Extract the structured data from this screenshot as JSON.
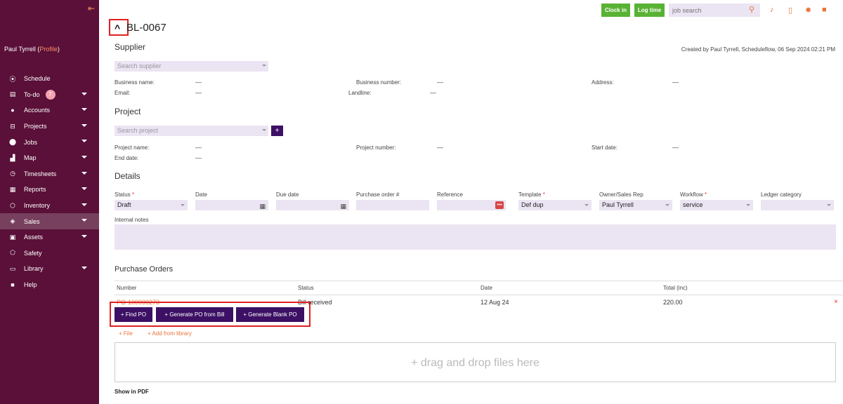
{
  "sidebar": {
    "collapse_icon": "collapse-left-icon",
    "user_name": "Paul Tyrrell",
    "profile_link": "Profile",
    "items": [
      {
        "label": "Schedule",
        "icon": "schedule-icon",
        "glyph": "⦿",
        "has_caret": false,
        "badge": ""
      },
      {
        "label": "To-do",
        "icon": "todo-icon",
        "glyph": "▤",
        "has_caret": true,
        "badge": "7"
      },
      {
        "label": "Accounts",
        "icon": "accounts-icon",
        "glyph": "●",
        "has_caret": true,
        "badge": ""
      },
      {
        "label": "Projects",
        "icon": "projects-icon",
        "glyph": "⊟",
        "has_caret": true,
        "badge": ""
      },
      {
        "label": "Jobs",
        "icon": "jobs-icon",
        "glyph": "⬤",
        "has_caret": true,
        "badge": ""
      },
      {
        "label": "Map",
        "icon": "map-icon",
        "glyph": "▟",
        "has_caret": true,
        "badge": ""
      },
      {
        "label": "Timesheets",
        "icon": "timesheets-icon",
        "glyph": "◷",
        "has_caret": true,
        "badge": ""
      },
      {
        "label": "Reports",
        "icon": "reports-icon",
        "glyph": "▦",
        "has_caret": true,
        "badge": ""
      },
      {
        "label": "Inventory",
        "icon": "inventory-icon",
        "glyph": "⬡",
        "has_caret": true,
        "badge": ""
      },
      {
        "label": "Sales",
        "icon": "sales-icon",
        "glyph": "◈",
        "has_caret": true,
        "badge": "",
        "active": true
      },
      {
        "label": "Assets",
        "icon": "assets-icon",
        "glyph": "▣",
        "has_caret": true,
        "badge": ""
      },
      {
        "label": "Safety",
        "icon": "safety-icon",
        "glyph": "⬠",
        "has_caret": false,
        "badge": ""
      },
      {
        "label": "Library",
        "icon": "library-icon",
        "glyph": "▭",
        "has_caret": true,
        "badge": ""
      },
      {
        "label": "Help",
        "icon": "help-icon",
        "glyph": "■",
        "has_caret": false,
        "badge": ""
      }
    ]
  },
  "topbar": {
    "clock_in": "Clock in",
    "log_time": "Log time",
    "search_placeholder": "job search"
  },
  "header": {
    "title": "BL-0067",
    "created": "Created by Paul Tyrrell, Scheduleflow, 06 Sep 2024 02:21 PM"
  },
  "supplier": {
    "title": "Supplier",
    "search_placeholder": "Search supplier",
    "business_name_label": "Business name:",
    "business_name_value": "—",
    "business_number_label": "Business number:",
    "business_number_value": "—",
    "address_label": "Address:",
    "address_value": "—",
    "email_label": "Email:",
    "email_value": "—",
    "landline_label": "Landline:",
    "landline_value": "—"
  },
  "project": {
    "title": "Project",
    "search_placeholder": "Search project",
    "add_label": "+",
    "project_name_label": "Project name:",
    "project_name_value": "—",
    "project_number_label": "Project number:",
    "project_number_value": "—",
    "start_date_label": "Start date:",
    "start_date_value": "—",
    "end_date_label": "End date:",
    "end_date_value": "—"
  },
  "details": {
    "title": "Details",
    "status_label": "Status",
    "status_value": "Draft",
    "date_label": "Date",
    "date_value": "",
    "due_date_label": "Due date",
    "due_date_value": "",
    "po_number_label": "Purchase order #",
    "po_number_value": "",
    "reference_label": "Reference",
    "reference_value": "",
    "template_label": "Template",
    "template_value": "Def dup",
    "owner_label": "Owner/Sales Rep",
    "owner_value": "Paul Tyrrell",
    "workflow_label": "Workflow",
    "workflow_value": "service",
    "ledger_label": "Ledger category",
    "ledger_value": "",
    "internal_notes_label": "Internal notes",
    "required_mark": "*"
  },
  "purchase_orders": {
    "title": "Purchase Orders",
    "columns": [
      "Number",
      "Status",
      "Date",
      "Total (inc)"
    ],
    "rows": [
      {
        "number": "PO-100000273",
        "status": "Bill received",
        "date": "12 Aug 24",
        "total": "220.00"
      }
    ],
    "delete_glyph": "×",
    "buttons": {
      "find_po": "+ Find PO",
      "generate_from_bill": "+ Generate PO from Bill",
      "generate_blank": "+ Generate Blank PO"
    }
  },
  "files": {
    "file_link": "+ File",
    "library_link": "+ Add from library",
    "dropzone_text": "+ drag and drop files here",
    "show_in_pdf": "Show in PDF"
  },
  "colors": {
    "sidebar_bg": "#5a1038",
    "accent": "#e8743b",
    "primary_button": "#3c1064",
    "green_button": "#58b233",
    "field_bg": "#ebe4f2",
    "highlight": "#e02020"
  }
}
